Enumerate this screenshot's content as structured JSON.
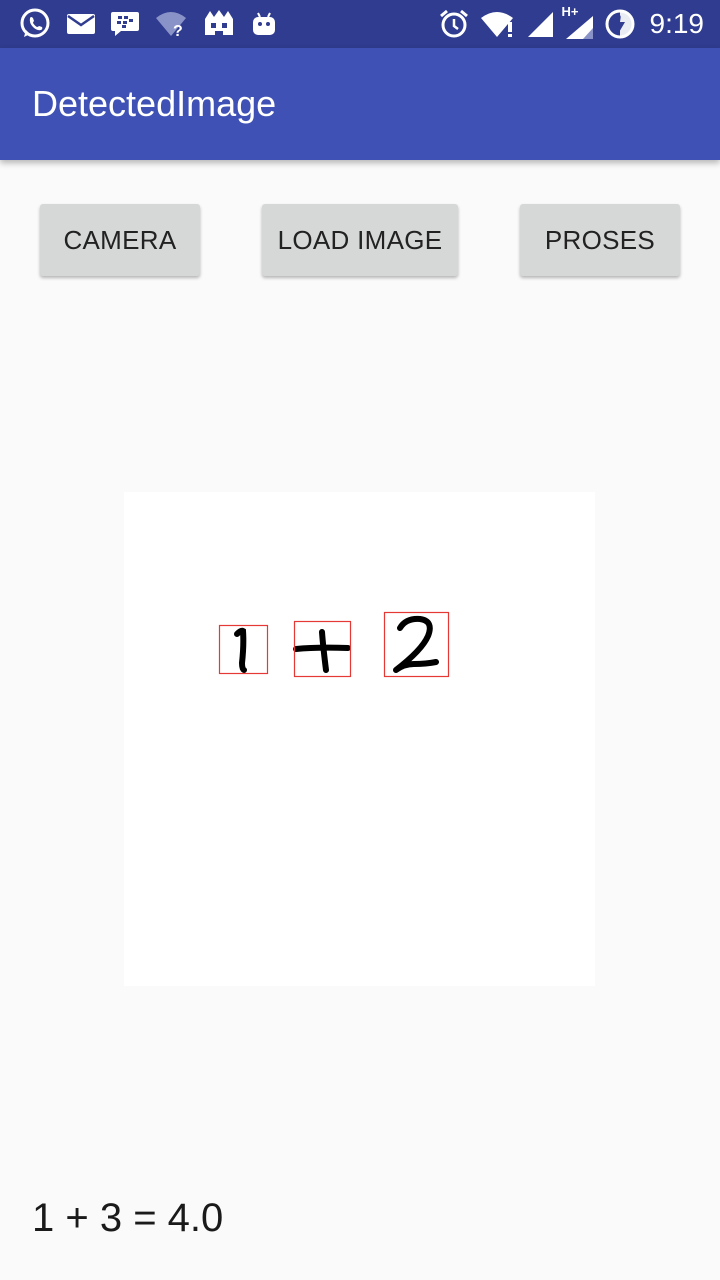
{
  "status_bar": {
    "time": "9:19",
    "network_label": "H+",
    "icons": [
      "whatsapp-icon",
      "mail-icon",
      "bbm-icon",
      "wifi-question-icon",
      "clash-icon",
      "android-icon",
      "alarm-icon",
      "wifi-alert-icon",
      "signal-icon",
      "signal-hplus-icon",
      "battery-charging-icon"
    ]
  },
  "app_bar": {
    "title": "DetectedImage"
  },
  "buttons": {
    "camera": "CAMERA",
    "load_image": "LOAD IMAGE",
    "proses": "PROSES"
  },
  "image": {
    "detected_symbols": [
      "1",
      "+",
      "2"
    ],
    "box_color": "#e53935"
  },
  "result": {
    "text": "1 + 3 = 4.0"
  },
  "colors": {
    "status_bar": "#2f3c8f",
    "app_bar": "#3f51b5",
    "button": "#d6d7d7",
    "background": "#fafafa"
  }
}
